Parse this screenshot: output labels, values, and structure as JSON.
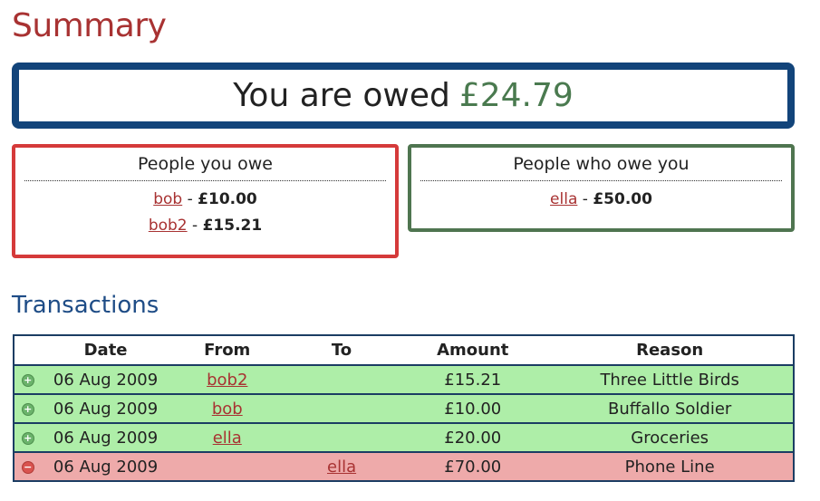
{
  "summary": {
    "title": "Summary",
    "owed_prefix": "You are owed",
    "owed_amount": "£24.79"
  },
  "people_you_owe": {
    "heading": "People you owe",
    "entries": [
      {
        "name": "bob",
        "sep": " - ",
        "amount": "£10.00"
      },
      {
        "name": "bob2",
        "sep": " - ",
        "amount": "£15.21"
      }
    ]
  },
  "people_who_owe_you": {
    "heading": "People who owe you",
    "entries": [
      {
        "name": "ella",
        "sep": " - ",
        "amount": "£50.00"
      }
    ]
  },
  "transactions": {
    "title": "Transactions",
    "columns": [
      "Date",
      "From",
      "To",
      "Amount",
      "Reason"
    ],
    "rows": [
      {
        "direction": "in",
        "icon": "plus-circle-icon",
        "date": "06 Aug 2009",
        "from": "bob2",
        "to": "",
        "amount": "£15.21",
        "reason": "Three Little Birds"
      },
      {
        "direction": "in",
        "icon": "plus-circle-icon",
        "date": "06 Aug 2009",
        "from": "bob",
        "to": "",
        "amount": "£10.00",
        "reason": "Buffallo Soldier"
      },
      {
        "direction": "in",
        "icon": "plus-circle-icon",
        "date": "06 Aug 2009",
        "from": "ella",
        "to": "",
        "amount": "£20.00",
        "reason": "Groceries"
      },
      {
        "direction": "out",
        "icon": "minus-circle-icon",
        "date": "06 Aug 2009",
        "from": "",
        "to": "ella",
        "amount": "£70.00",
        "reason": "Phone Line"
      }
    ]
  },
  "colors": {
    "title_red": "#a83232",
    "owed_green": "#4a7a4f",
    "owed_border": "#12447a",
    "owe_border": "#d53a3a",
    "owed_you_border": "#4f7550",
    "incoming_row": "#aeeea8",
    "outgoing_row": "#eeaaaa"
  }
}
